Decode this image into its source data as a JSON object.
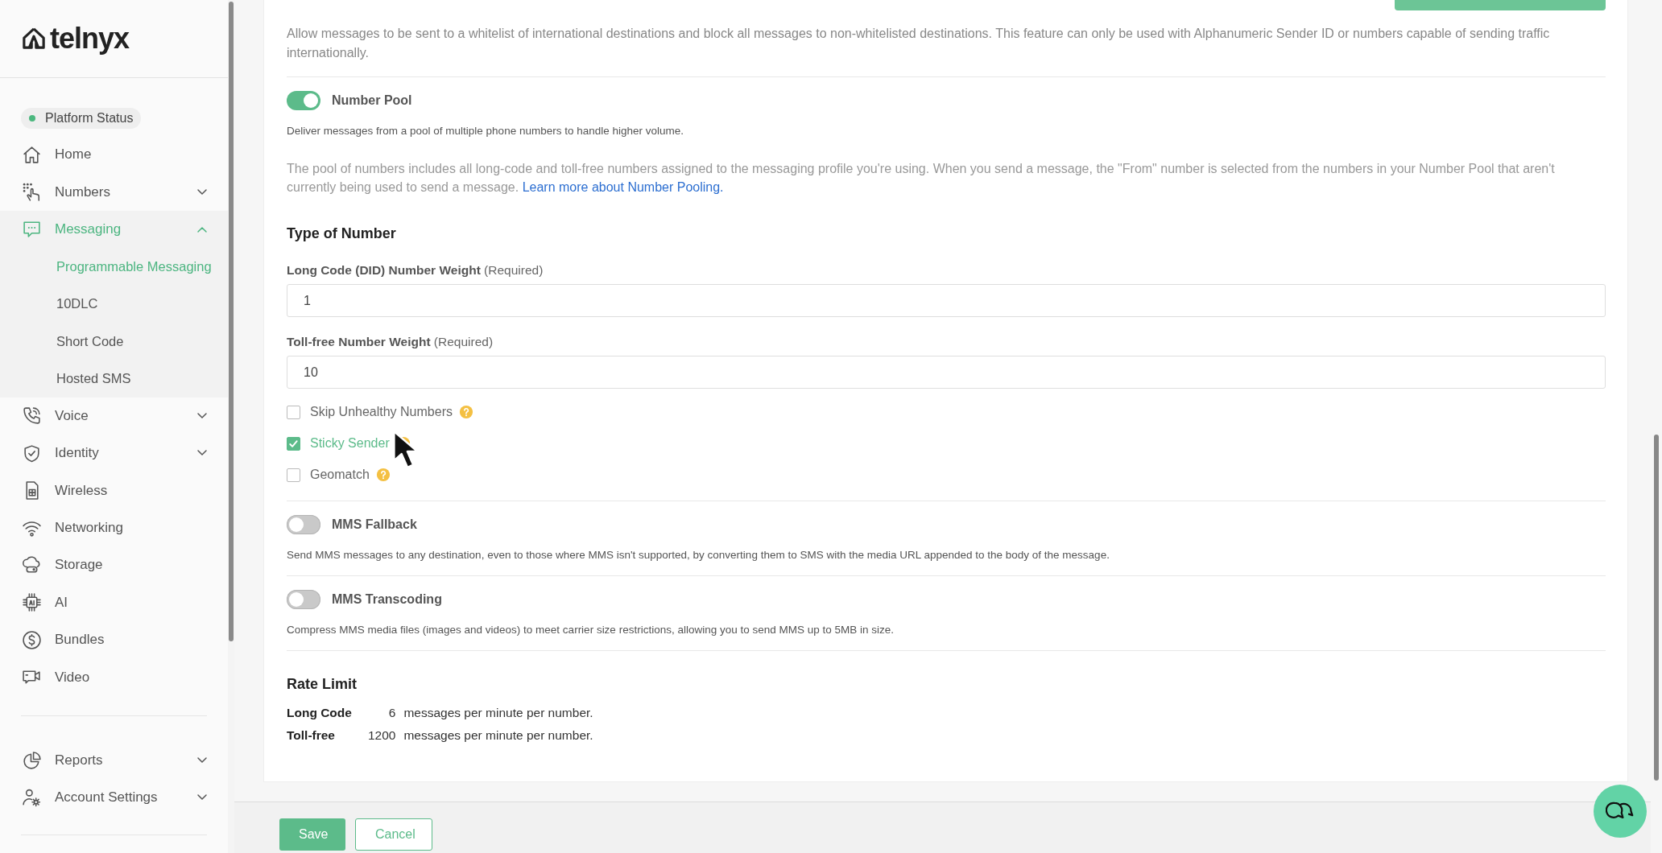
{
  "brand": {
    "name": "telnyx"
  },
  "sidebar": {
    "status": {
      "label": "Platform Status",
      "color": "#4cb87f"
    },
    "items": [
      {
        "label": "Home",
        "selected": false
      },
      {
        "label": "Numbers",
        "selected": false,
        "expanded": false
      },
      {
        "label": "Messaging",
        "selected": true,
        "expanded": true,
        "children": [
          {
            "label": "Programmable Messaging",
            "selected": true
          },
          {
            "label": "10DLC",
            "selected": false
          },
          {
            "label": "Short Code",
            "selected": false
          },
          {
            "label": "Hosted SMS",
            "selected": false
          }
        ]
      },
      {
        "label": "Voice",
        "selected": false,
        "expanded": false
      },
      {
        "label": "Identity",
        "selected": false,
        "expanded": false
      },
      {
        "label": "Wireless",
        "selected": false
      },
      {
        "label": "Networking",
        "selected": false
      },
      {
        "label": "Storage",
        "selected": false
      },
      {
        "label": "AI",
        "selected": false
      },
      {
        "label": "Bundles",
        "selected": false
      },
      {
        "label": "Video",
        "selected": false
      }
    ],
    "bottom_items": [
      {
        "label": "Reports",
        "selected": false,
        "expanded": false
      },
      {
        "label": "Account Settings",
        "selected": false,
        "expanded": false
      }
    ]
  },
  "intro": "Allow messages to be sent to a whitelist of international destinations and block all messages to non-whitelisted destinations. This feature can only be used with Alphanumeric Sender ID or numbers capable of sending traffic internationally.",
  "number_pool": {
    "title": "Number Pool",
    "on": true,
    "description": "Deliver messages from a pool of multiple phone numbers to handle higher volume.",
    "note": "The pool of numbers includes all long-code and toll-free numbers assigned to the messaging profile you're using. When you send a message, the \"From\" number is selected from the numbers in your Number Pool that aren't currently being used to send a message.",
    "link": "Learn more about Number Pooling."
  },
  "type_of_number": {
    "title": "Type of Number",
    "fields": [
      {
        "label": "Long Code (DID) Number Weight",
        "hint": "(Required)",
        "value": "1"
      },
      {
        "label": "Toll-free Number Weight",
        "hint": "(Required)",
        "value": "10"
      }
    ],
    "options": [
      {
        "label": "Skip Unhealthy Numbers",
        "checked": false
      },
      {
        "label": "Sticky Sender",
        "checked": true
      },
      {
        "label": "Geomatch",
        "checked": false
      }
    ]
  },
  "toggles": [
    {
      "title": "MMS Fallback",
      "on": false,
      "description": "Send MMS messages to any destination, even to those where MMS isn't supported, by converting them to SMS with the media URL appended to the body of the message."
    },
    {
      "title": "MMS Transcoding",
      "on": false,
      "description": "Compress MMS media files (images and videos) to meet carrier size restrictions, allowing you to send MMS up to 5MB in size."
    }
  ],
  "rate_limit": {
    "title": "Rate Limit",
    "rows": [
      {
        "type": "Long Code",
        "value": "6",
        "unit": "messages per minute per number."
      },
      {
        "type": "Toll-free",
        "value": "1200",
        "unit": "messages per minute per number."
      }
    ]
  },
  "footer": {
    "buttons": [
      {
        "label": "Save",
        "kind": "primary"
      },
      {
        "label": "Cancel",
        "kind": "secondary"
      }
    ]
  }
}
